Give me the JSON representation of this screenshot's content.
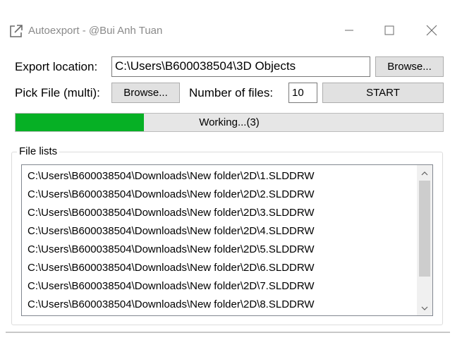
{
  "window": {
    "title": "Autoexport - @Bui Anh Tuan",
    "icons": {
      "app": "external-link-icon",
      "minimize": "minimize-icon",
      "maximize": "maximize-icon",
      "close": "close-icon"
    }
  },
  "export": {
    "label": "Export location:",
    "path": "C:\\Users\\B600038504\\3D Objects",
    "browse_label": "Browse..."
  },
  "pick": {
    "label": "Pick File (multi):",
    "browse_label": "Browse...",
    "count_label": "Number of files:",
    "count_value": "10",
    "start_label": "START"
  },
  "progress": {
    "text": "Working...(3)",
    "fraction": 0.3,
    "color": "#06b025"
  },
  "file_list": {
    "legend": "File lists",
    "items": [
      "C:\\Users\\B600038504\\Downloads\\New folder\\2D\\1.SLDDRW",
      "C:\\Users\\B600038504\\Downloads\\New folder\\2D\\2.SLDDRW",
      "C:\\Users\\B600038504\\Downloads\\New folder\\2D\\3.SLDDRW",
      "C:\\Users\\B600038504\\Downloads\\New folder\\2D\\4.SLDDRW",
      "C:\\Users\\B600038504\\Downloads\\New folder\\2D\\5.SLDDRW",
      "C:\\Users\\B600038504\\Downloads\\New folder\\2D\\6.SLDDRW",
      "C:\\Users\\B600038504\\Downloads\\New folder\\2D\\7.SLDDRW",
      "C:\\Users\\B600038504\\Downloads\\New folder\\2D\\8.SLDDRW"
    ],
    "icons": {
      "scroll_up": "chevron-up-icon",
      "scroll_down": "chevron-down-icon"
    }
  }
}
